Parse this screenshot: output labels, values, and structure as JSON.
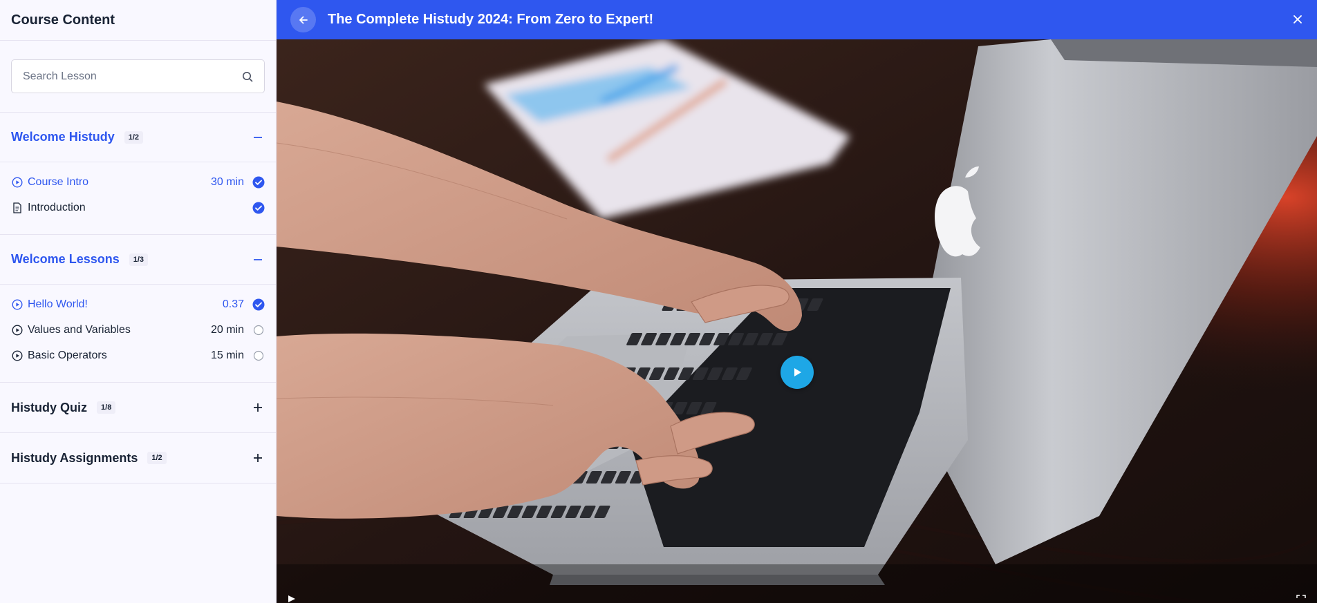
{
  "sidebar": {
    "title": "Course Content",
    "search": {
      "placeholder": "Search Lesson",
      "value": "",
      "icon": "search-icon"
    },
    "sections": [
      {
        "title": "Welcome Histudy",
        "count": "1/2",
        "expanded": true,
        "lessons": [
          {
            "label": "Course Intro",
            "duration": "30 min",
            "type": "video",
            "completed": true,
            "active": true
          },
          {
            "label": "Introduction",
            "duration": "",
            "type": "document",
            "completed": true,
            "active": false
          }
        ]
      },
      {
        "title": "Welcome Lessons",
        "count": "1/3",
        "expanded": true,
        "lessons": [
          {
            "label": "Hello World!",
            "duration": "0.37",
            "type": "video",
            "completed": true,
            "active": true
          },
          {
            "label": "Values and Variables",
            "duration": "20 min",
            "type": "video",
            "completed": false,
            "active": false
          },
          {
            "label": "Basic Operators",
            "duration": "15 min",
            "type": "video",
            "completed": false,
            "active": false
          }
        ]
      },
      {
        "title": "Histudy Quiz",
        "count": "1/8",
        "expanded": false,
        "lessons": []
      },
      {
        "title": "Histudy Assignments",
        "count": "1/2",
        "expanded": false,
        "lessons": []
      }
    ]
  },
  "player": {
    "title": "The Complete Histudy 2024: From Zero to Expert!",
    "back_icon": "arrow-left-icon",
    "close_icon": "close-icon",
    "play_icon": "play-icon"
  },
  "colors": {
    "accent": "#2f57ef",
    "play_button": "#1ea7e6",
    "sidebar_bg": "#f9f8ff",
    "text": "#192335"
  }
}
